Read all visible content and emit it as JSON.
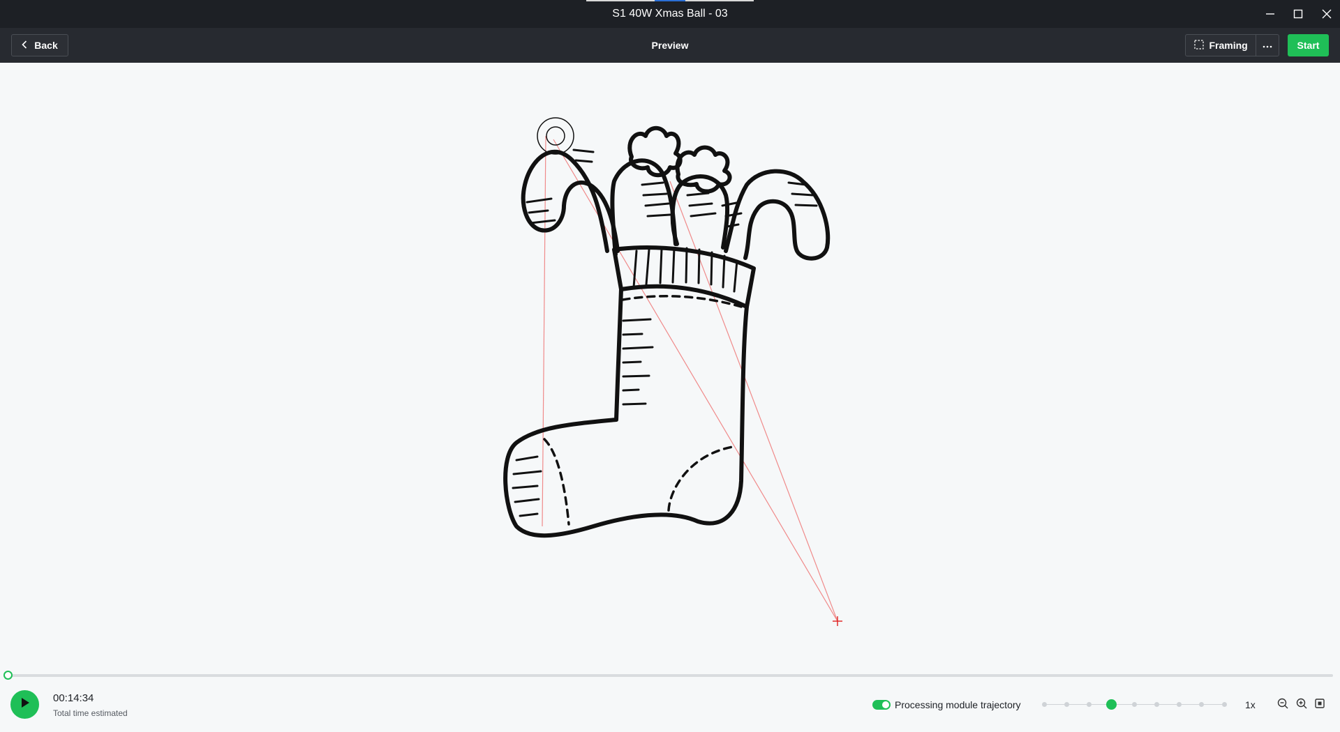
{
  "window": {
    "title": "S1 40W Xmas Ball - 03"
  },
  "toolbar": {
    "back_label": "Back",
    "page_title": "Preview",
    "framing_label": "Framing",
    "start_label": "Start"
  },
  "playback": {
    "time": "00:14:34",
    "time_label": "Total time estimated",
    "progress": 0,
    "trajectory_label": "Processing module trajectory",
    "trajectory_enabled": true,
    "speed_steps": 9,
    "speed_selected_index": 3,
    "speed_label": "1x"
  },
  "colors": {
    "accent_green": "#1fbf57",
    "titlebar_bg": "#1d2025",
    "toolbar_bg": "#272a30",
    "canvas_bg": "#f6f8f9",
    "trajectory_red": "#f08a8a"
  },
  "icons": [
    "minimize-icon",
    "maximize-icon",
    "close-icon",
    "chevron-left-icon",
    "framing-icon",
    "more-icon",
    "play-icon",
    "zoom-out-icon",
    "zoom-in-icon",
    "fit-screen-icon",
    "crosshair-icon"
  ]
}
